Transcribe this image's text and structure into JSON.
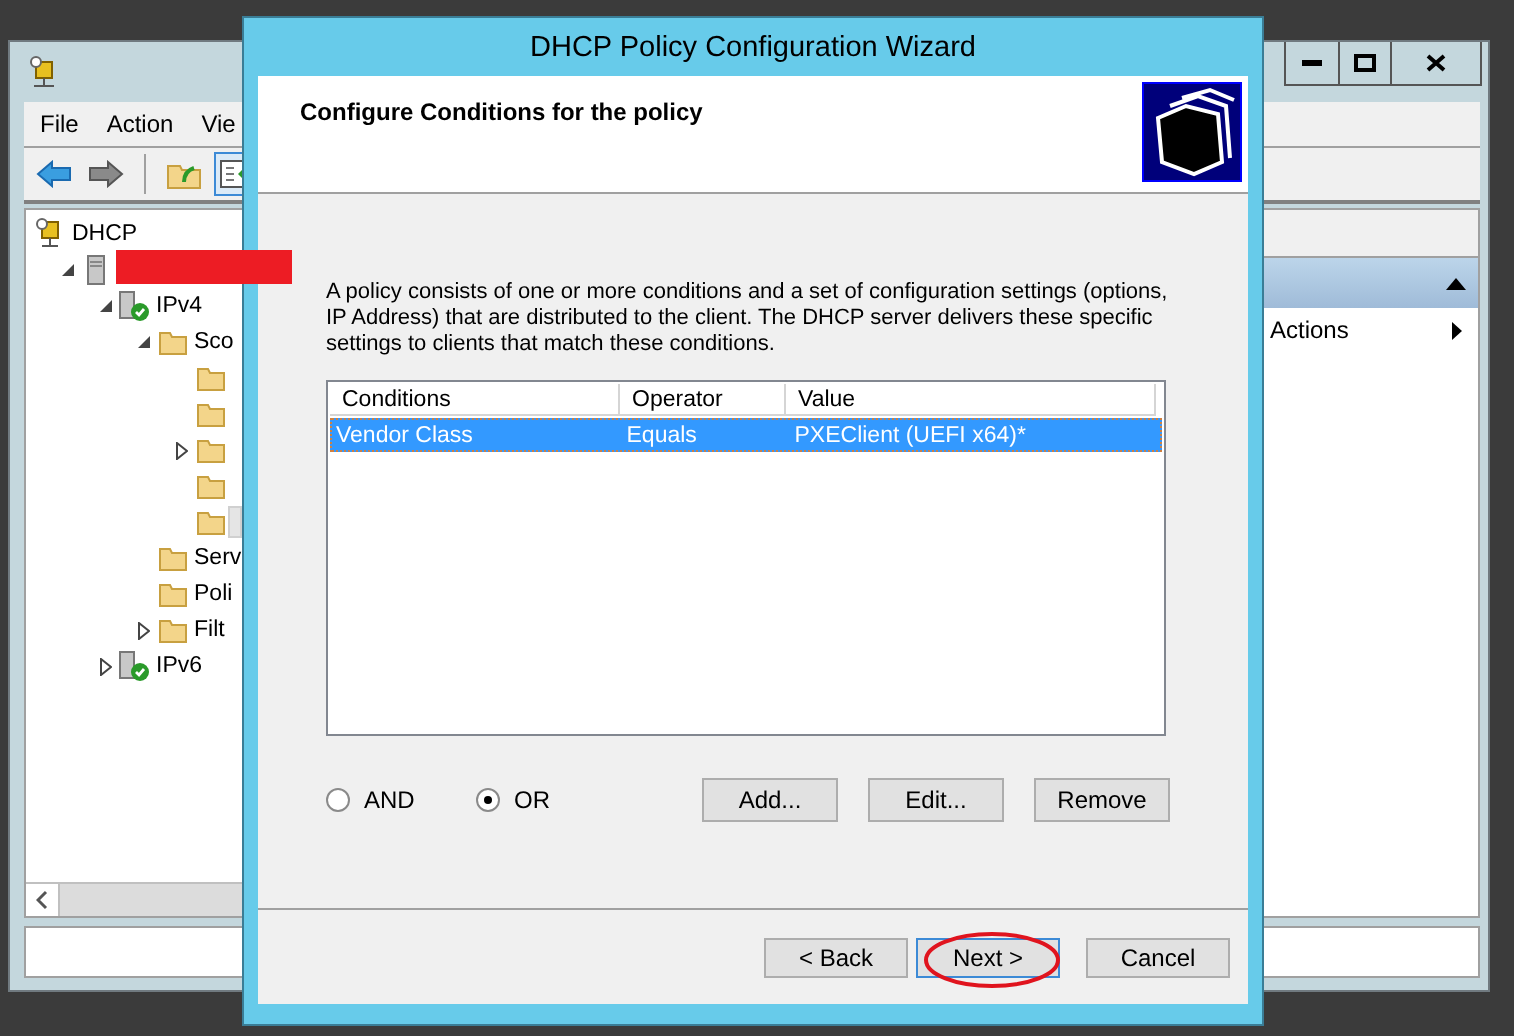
{
  "console": {
    "menu": [
      "File",
      "Action",
      "Vie"
    ],
    "tree": [
      {
        "label": "DHCP",
        "selected": false,
        "children": [
          {
            "redacted": true,
            "expanded": true,
            "selected": false,
            "children": [
              {
                "label": "IPv4",
                "expanded": true,
                "selected": false,
                "children": [
                  {
                    "label": "Sco",
                    "expanded": true,
                    "selected": false,
                    "children": [
                      {
                        "selected": false
                      },
                      {
                        "selected": false
                      },
                      {
                        "expanded": false,
                        "selected": false
                      },
                      {
                        "selected": false
                      },
                      {
                        "selected": true
                      }
                    ]
                  },
                  {
                    "label": "Serv",
                    "selected": false
                  },
                  {
                    "label": "Poli",
                    "selected": false
                  },
                  {
                    "label": "Filt",
                    "expanded": false,
                    "selected": false
                  }
                ]
              },
              {
                "label": "IPv6",
                "expanded": false,
                "selected": false
              }
            ]
          }
        ]
      }
    ],
    "actions": [
      "Actions"
    ]
  },
  "dialog": {
    "title": "DHCP Policy Configuration Wizard",
    "heading": "Configure Conditions for the policy",
    "description": "A policy consists of one or more conditions and a set of configuration settings (options, IP Address) that are distributed to the client. The DHCP server delivers these specific settings to clients that match these conditions.",
    "conditions": {
      "columns": [
        "Conditions",
        "Operator",
        "Value"
      ],
      "rows": [
        {
          "cells": [
            "Vendor Class",
            "Equals",
            "PXEClient (UEFI x64)*"
          ],
          "selected": true
        }
      ]
    },
    "logic": [
      {
        "label": "AND",
        "selected": false
      },
      {
        "label": "OR",
        "selected": true
      }
    ],
    "list_buttons": [
      "Add...",
      "Edit...",
      "Remove"
    ],
    "nav_buttons": [
      {
        "label": "< Back",
        "focused": false,
        "circled": false
      },
      {
        "label": "Next >",
        "focused": true,
        "circled": true
      },
      {
        "label": "Cancel",
        "focused": false,
        "circled": false
      }
    ]
  }
}
